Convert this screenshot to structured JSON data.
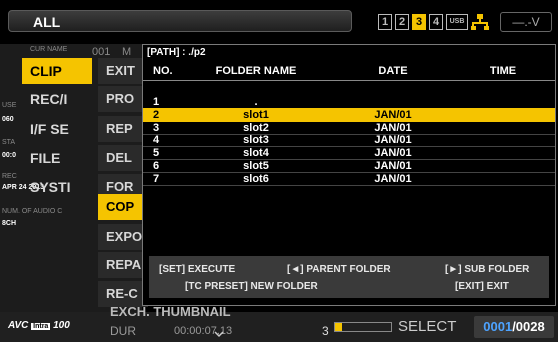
{
  "header": {
    "title": "ALL"
  },
  "slots": [
    "1",
    "2",
    "3",
    "4",
    "USB"
  ],
  "active_slot": "3",
  "icons": {
    "network": "network-icon",
    "signal": "signal-icon"
  },
  "signal_text": "—.-V",
  "colors": {
    "accent": "#f5c400",
    "count": "#4da3ff",
    "hint_bg": "#3a3a3a"
  },
  "background_menu": {
    "faint": [
      "CUR NAME",
      "001",
      "M",
      "USE",
      "060",
      "STA",
      "00:0",
      "REC",
      "APR 24 2013"
    ],
    "level1": [
      "CLIP",
      "REC/I",
      "I/F SE",
      "FILE",
      "SYSTI"
    ],
    "level1_selected": "CLIP",
    "level2": [
      "EXIT",
      "PRO",
      "REP",
      "DEL",
      "FOR",
      "COP",
      "EXPO",
      "REPA",
      "RE-C"
    ],
    "level2_selected": "COP",
    "num_audio_label": "NUM. OF AUDIO C",
    "num_audio_value": "8CH"
  },
  "dialog": {
    "path": "[PATH] : ./p2",
    "columns": {
      "no": "NO.",
      "name": "FOLDER NAME",
      "date": "DATE",
      "time": "TIME"
    },
    "rows": [
      {
        "no": "1",
        "name": ".",
        "date": "",
        "time": ""
      },
      {
        "no": "2",
        "name": "slot1",
        "date": "JAN/01",
        "time": ""
      },
      {
        "no": "3",
        "name": "slot2",
        "date": "JAN/01",
        "time": ""
      },
      {
        "no": "4",
        "name": "slot3",
        "date": "JAN/01",
        "time": ""
      },
      {
        "no": "5",
        "name": "slot4",
        "date": "JAN/01",
        "time": ""
      },
      {
        "no": "6",
        "name": "slot5",
        "date": "JAN/01",
        "time": ""
      },
      {
        "no": "7",
        "name": "slot6",
        "date": "JAN/01",
        "time": ""
      }
    ],
    "selected_row": 1,
    "hints": {
      "execute": "[SET] EXECUTE",
      "parent": "[◄] PARENT FOLDER",
      "sub": "[►] SUB FOLDER",
      "new_folder": "[TC PRESET] NEW FOLDER",
      "exit": "[EXIT] EXIT"
    }
  },
  "bottom": {
    "logo": "AVC",
    "logo_intra": "Intra",
    "logo_suffix": "100",
    "exch_label": "EXCH. THUMBNAIL",
    "dur_label": "DUR",
    "timecode": "00:00:07.13",
    "three": "3",
    "progress": 0.12,
    "select_label": "SELECT",
    "select_current": "0001",
    "select_total": "/0028"
  }
}
